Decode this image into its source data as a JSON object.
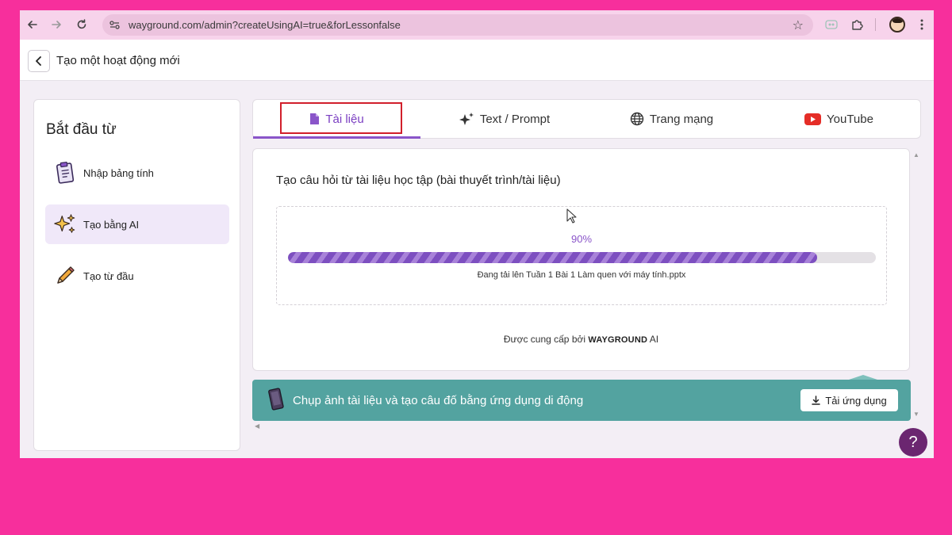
{
  "browser": {
    "url": "wayground.com/admin?createUsingAI=true&forLessonfalse",
    "icons": [
      "back-arrow-icon",
      "forward-arrow-icon",
      "reload-icon",
      "site-settings-icon",
      "bookmark-star-icon",
      "extension-icon",
      "puzzle-icon",
      "profile-avatar",
      "more-menu-icon"
    ]
  },
  "header": {
    "title": "Tạo một hoạt động mới"
  },
  "sidebar": {
    "title": "Bắt đầu từ",
    "items": [
      {
        "label": "Nhập bảng tính",
        "icon": "clipboard-icon",
        "active": false
      },
      {
        "label": "Tạo bằng AI",
        "icon": "sparkles-icon",
        "active": true
      },
      {
        "label": "Tạo từ đầu",
        "icon": "pencil-icon",
        "active": false
      }
    ]
  },
  "tabs": [
    {
      "label": "Tài liệu",
      "icon": "document-icon",
      "active": true
    },
    {
      "label": "Text / Prompt",
      "icon": "sparkle-icon",
      "active": false
    },
    {
      "label": "Trang mạng",
      "icon": "globe-icon",
      "active": false
    },
    {
      "label": "YouTube",
      "icon": "youtube-icon",
      "active": false
    }
  ],
  "main": {
    "heading": "Tạo câu hỏi từ tài liệu học tập (bài thuyết trình/tài liệu)",
    "progress_text": "90%",
    "progress": 0.9,
    "status": "Đang tải lên Tuần 1 Bài 1 Làm quen với máy tính.pptx",
    "powered_prefix": "Được cung cấp bởi",
    "powered_brand": "WAYGROUND",
    "powered_suffix": "AI"
  },
  "banner": {
    "text": "Chụp ảnh tài liệu và tạo câu đố bằng ứng dụng di động",
    "button_label": "Tải ứng dụng"
  },
  "help": {
    "label": "?"
  },
  "colors": {
    "background": "#f72f9c",
    "accent": "#8a55c9",
    "banner": "#53a3a0",
    "highlight": "#d11f2b",
    "help": "#6b2670"
  }
}
